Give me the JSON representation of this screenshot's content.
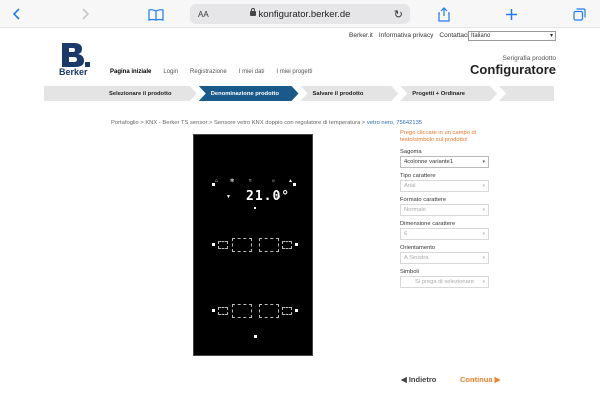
{
  "browser": {
    "url_prefix": "AA",
    "url": "konfigurator.berker.de"
  },
  "top_links": [
    "Berker.it",
    "Informativa privacy",
    "Contattaci"
  ],
  "language": "Italiano",
  "logo": {
    "text": "Berker"
  },
  "nav": [
    "Pagina iniziale",
    "Login",
    "Registrazione",
    "I miei dati",
    "I miei progetti"
  ],
  "header": {
    "subtitle": "Serigrafia prodotto",
    "title": "Configuratore"
  },
  "steps": [
    "Selezionare il prodotto",
    "Denominazione prodotto",
    "Salvare il prodotto",
    "Progetti + Ordinare"
  ],
  "breadcrumb": {
    "path": "Portafoglio > KNX - Berker TS sensor > Sensore vetro KNX doppio con regolatore di temperatura > ",
    "current": "vetro nero, 75642135"
  },
  "preview": {
    "temperature": "21.0°"
  },
  "panel": {
    "hint": "Prego cliccare in un campo di testo/simbolo sul prodotto!",
    "fields": [
      {
        "label": "Sagoma",
        "value": "4colonne variante1",
        "enabled": true
      },
      {
        "label": "Tipo carattere",
        "value": "Arial",
        "enabled": false
      },
      {
        "label": "Formato carattere",
        "value": "Normale",
        "enabled": false
      },
      {
        "label": "Dimensione carattere",
        "value": "6",
        "enabled": false
      },
      {
        "label": "Orientamento",
        "value": "A Sinistra",
        "enabled": false
      },
      {
        "label": "Simboli",
        "value": "Si prega di selezionare",
        "enabled": false
      }
    ]
  },
  "footer": {
    "back": "◀ Indietro",
    "next": "Continua ▶"
  },
  "colors": {
    "accent": "#e8822c",
    "step_active": "#1a5a8a",
    "link": "#1e7cf2"
  }
}
